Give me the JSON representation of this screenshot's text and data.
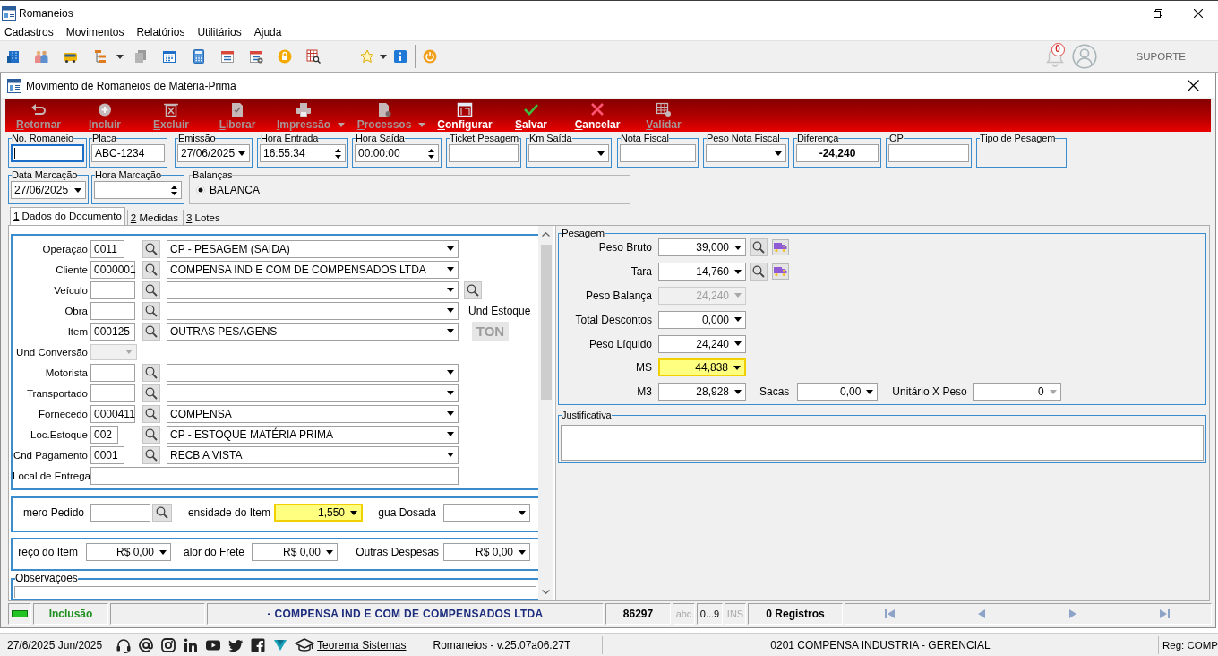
{
  "window": {
    "title": "Romaneios"
  },
  "menu": [
    "Cadastros",
    "Movimentos",
    "Relatórios",
    "Utilitários",
    "Ajuda"
  ],
  "toolbar": {
    "notifications": "0",
    "user": "SUPORTE"
  },
  "form": {
    "title": "Movimento de Romaneios de Matéria-Prima"
  },
  "actions": [
    {
      "label": "Retornar",
      "kind": "button",
      "disabled": true
    },
    {
      "label": "Incluir",
      "kind": "button",
      "disabled": true
    },
    {
      "label": "Excluir",
      "kind": "button",
      "disabled": true
    },
    {
      "label": "Liberar",
      "kind": "button",
      "disabled": true
    },
    {
      "label": "Impressão",
      "kind": "dropdown",
      "disabled": true
    },
    {
      "label": "Processos",
      "kind": "dropdown",
      "disabled": true
    },
    {
      "label": "Configurar",
      "kind": "button",
      "disabled": false
    },
    {
      "label": "Salvar",
      "kind": "button",
      "disabled": false
    },
    {
      "label": "Cancelar",
      "kind": "button",
      "disabled": false
    },
    {
      "label": "Validar",
      "kind": "button",
      "disabled": true
    }
  ],
  "header_fields": [
    {
      "label": "No. Romaneio",
      "kind": "text",
      "focused": true
    },
    {
      "label": "Placa",
      "kind": "text",
      "value": "ABC-1234",
      "focused": false
    },
    {
      "label": "Emissão",
      "kind": "date",
      "value": "27/06/2025",
      "focused": false
    },
    {
      "label": "Hora Entrada",
      "kind": "time",
      "value": "16:55:34",
      "focused": false
    },
    {
      "label": "Hora Saída",
      "kind": "time",
      "value": "00:00:00",
      "focused": false
    },
    {
      "label": "Ticket Pesagem",
      "kind": "text",
      "focused": false
    },
    {
      "label": "Km Saída",
      "kind": "combo",
      "focused": false
    },
    {
      "label": "Nota Fiscal",
      "kind": "text",
      "focused": false
    },
    {
      "label": "Peso Nota Fiscal",
      "kind": "combo",
      "focused": false
    },
    {
      "label": "Diferença",
      "kind": "total",
      "value": "-24,240",
      "focused": false
    },
    {
      "label": "OP",
      "kind": "text",
      "focused": false
    },
    {
      "label": "Tipo de Pesagem",
      "kind": "group"
    }
  ],
  "marking_fields": [
    {
      "label": "Data Marcação",
      "kind": "date",
      "value": "27/06/2025"
    },
    {
      "label": "Hora Marcação",
      "kind": "time"
    }
  ],
  "scales": {
    "label": "Balanças",
    "options": [
      {
        "label": "BALANCA",
        "selected": true
      }
    ]
  },
  "tabs": [
    {
      "label": "1 Dados do Documento",
      "selected": true
    },
    {
      "label": "2 Medidas",
      "selected": false
    },
    {
      "label": "3 Lotes",
      "selected": false
    }
  ],
  "document_rows": [
    {
      "label": "Operação",
      "kind": "lookup",
      "code": "0011",
      "description": "CP - PESAGEM (SAIDA)",
      "disabled": false
    },
    {
      "label": "Cliente",
      "kind": "lookup",
      "code": "0000001",
      "description": "COMPENSA IND E COM DE COMPENSADOS LTDA",
      "disabled": false
    },
    {
      "label": "Veículo",
      "kind": "searchable",
      "disabled": false
    },
    {
      "label": "Obra",
      "kind": "lookup",
      "disabled": false
    },
    {
      "label": "Item",
      "kind": "lookup",
      "code": "000125",
      "description": "OUTRAS PESAGENS",
      "disabled": false
    },
    {
      "label": "Und Conversão",
      "kind": "unit",
      "disabled": true
    },
    {
      "label": "Motorista",
      "kind": "lookup",
      "disabled": false
    },
    {
      "label": "Transportado",
      "kind": "lookup",
      "disabled": false
    },
    {
      "label": "Fornecedo",
      "kind": "lookup",
      "code": "0000411",
      "description": "COMPENSA",
      "disabled": false
    },
    {
      "label": "Loc.Estoque",
      "kind": "lookup",
      "code": "002",
      "description": "CP - ESTOQUE MATÉRIA PRIMA",
      "disabled": false
    },
    {
      "label": "Cnd Pagamento",
      "kind": "lookup",
      "code": "0001",
      "description": "RECB A VISTA",
      "disabled": false
    },
    {
      "label": "Local de Entrega",
      "kind": "text",
      "disabled": false
    }
  ],
  "stock_unit": {
    "label": "Und Estoque",
    "value": "TON"
  },
  "order_fields": [
    {
      "label": "mero Pedido",
      "kind": "lookup",
      "highlighted": false
    },
    {
      "label": "ensidade do Item",
      "kind": "number",
      "value": "1,550",
      "highlighted": true
    },
    {
      "label": "gua Dosada",
      "kind": "number",
      "highlighted": false
    }
  ],
  "price_fields": [
    {
      "label": "reço do Item",
      "value": "R$ 0,00"
    },
    {
      "label": "alor do Frete",
      "value": "R$ 0,00"
    },
    {
      "label": "Outras Despesas",
      "value": "R$ 0,00"
    }
  ],
  "observations": {
    "label": "Observações"
  },
  "weighing": {
    "label": "Pesagem",
    "rows": [
      {
        "label": "Peso Bruto",
        "value": "39,000",
        "kind": "lookup",
        "disabled": false,
        "highlighted": false
      },
      {
        "label": "Tara",
        "value": "14,760",
        "kind": "lookup",
        "disabled": false,
        "highlighted": false
      },
      {
        "label": "Peso Balança",
        "value": "24,240",
        "kind": "number",
        "disabled": true,
        "highlighted": false
      },
      {
        "label": "Total Descontos",
        "value": "0,000",
        "kind": "number",
        "disabled": false,
        "highlighted": false
      },
      {
        "label": "Peso Líquido",
        "value": "24,240",
        "kind": "number",
        "disabled": false,
        "highlighted": false
      },
      {
        "label": "MS",
        "value": "44,838",
        "kind": "number",
        "disabled": false,
        "highlighted": true
      },
      {
        "label": "M3",
        "value": "28,928",
        "kind": "number",
        "disabled": false,
        "highlighted": false,
        "extras": [
          {
            "label": "Sacas",
            "value": "0,00",
            "kind": "number"
          },
          {
            "label": "Unitário X Peso",
            "value": "0",
            "kind": "readonly"
          }
        ]
      }
    ]
  },
  "justification": {
    "label": "Justificativa"
  },
  "status_bar": {
    "mode": "Inclusão",
    "message": "- COMPENSA IND E COM DE COMPENSADOS LTDA",
    "number": "86297",
    "indicators": [
      {
        "label": "abc",
        "active": false
      },
      {
        "label": "0...9",
        "active": true
      },
      {
        "label": "INS",
        "active": false
      }
    ],
    "records": "0 Registros"
  },
  "footer": {
    "date": "27/6/2025 Jun/2025",
    "link": "Teorema Sistemas",
    "version": "Romaneios - v.25.07a06.27T",
    "company": "0201 COMPENSA INDUSTRIA - GERENCIAL",
    "register": "Reg: COMP"
  }
}
